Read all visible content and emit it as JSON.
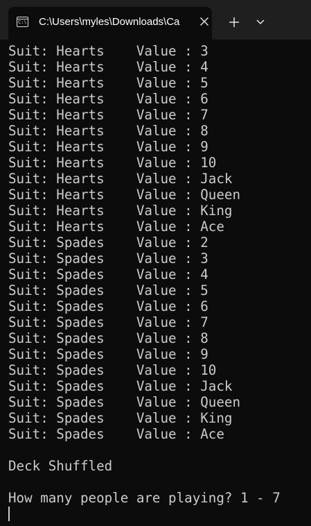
{
  "tab": {
    "title": "C:\\Users\\myles\\Downloads\\Ca",
    "icon_glyph": "C:\\",
    "icon": "terminal-icon"
  },
  "toolbar": {
    "new_tab_icon": "plus-icon",
    "dropdown_icon": "chevron-down-icon",
    "close_icon": "close-icon"
  },
  "terminal": {
    "lines": [
      "Suit: Hearts    Value : 3",
      "Suit: Hearts    Value : 4",
      "Suit: Hearts    Value : 5",
      "Suit: Hearts    Value : 6",
      "Suit: Hearts    Value : 7",
      "Suit: Hearts    Value : 8",
      "Suit: Hearts    Value : 9",
      "Suit: Hearts    Value : 10",
      "Suit: Hearts    Value : Jack",
      "Suit: Hearts    Value : Queen",
      "Suit: Hearts    Value : King",
      "Suit: Hearts    Value : Ace",
      "Suit: Spades    Value : 2",
      "Suit: Spades    Value : 3",
      "Suit: Spades    Value : 4",
      "Suit: Spades    Value : 5",
      "Suit: Spades    Value : 6",
      "Suit: Spades    Value : 7",
      "Suit: Spades    Value : 8",
      "Suit: Spades    Value : 9",
      "Suit: Spades    Value : 10",
      "Suit: Spades    Value : Jack",
      "Suit: Spades    Value : Queen",
      "Suit: Spades    Value : King",
      "Suit: Spades    Value : Ace",
      "",
      "Deck Shuffled",
      "",
      "How many people are playing? 1 - 7"
    ],
    "text_color": "#cccccc",
    "background": "#0c0c0c"
  }
}
